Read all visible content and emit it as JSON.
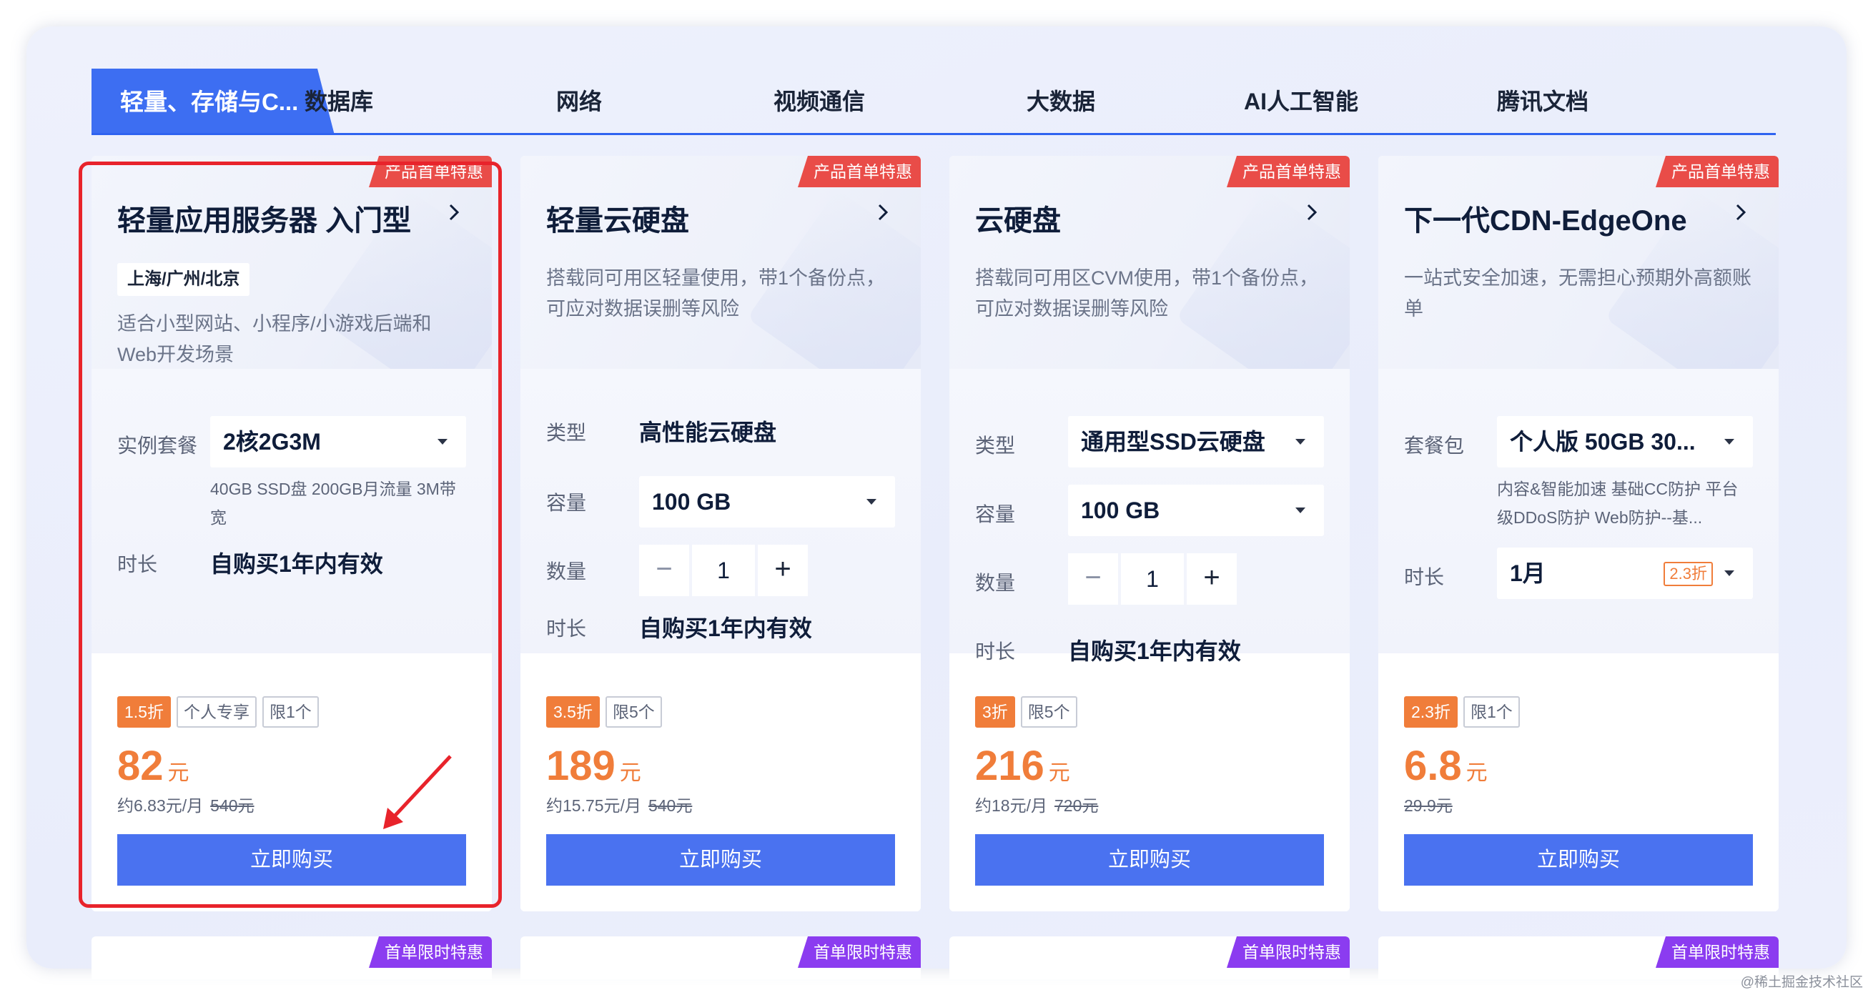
{
  "tabs": {
    "active": "轻量、存储与C...",
    "items": [
      "数据库",
      "网络",
      "视频通信",
      "大数据",
      "AI人工智能",
      "腾讯文档"
    ]
  },
  "cards": [
    {
      "badge": "产品首单特惠",
      "title": "轻量应用服务器 入门型",
      "region": "上海/广州/北京",
      "desc": "适合小型网站、小程序/小游戏后端和Web开发场景",
      "label_instance": "实例套餐",
      "instance_value": "2核2G3M",
      "instance_note": "40GB SSD盘 200GB月流量 3M带宽",
      "label_duration": "时长",
      "duration_value": "自购买1年内有效",
      "tags": [
        "1.5折",
        "个人专享",
        "限1个"
      ],
      "price": "82",
      "unit": "元",
      "monthly": "约6.83元/月",
      "original": "540元",
      "buy_label": "立即购买"
    },
    {
      "badge": "产品首单特惠",
      "title": "轻量云硬盘",
      "desc": "搭载同可用区轻量使用，带1个备份点，可应对数据误删等风险",
      "label_type": "类型",
      "type_value": "高性能云硬盘",
      "label_capacity": "容量",
      "capacity_value": "100 GB",
      "label_quantity": "数量",
      "stepper": {
        "minus": "−",
        "qty": "1",
        "plus": "+"
      },
      "label_duration": "时长",
      "duration_value": "自购买1年内有效",
      "tags": [
        "3.5折",
        "限5个"
      ],
      "price": "189",
      "unit": "元",
      "monthly": "约15.75元/月",
      "original": "540元",
      "buy_label": "立即购买"
    },
    {
      "badge": "产品首单特惠",
      "title": "云硬盘",
      "desc": "搭载同可用区CVM使用，带1个备份点，可应对数据误删等风险",
      "label_type": "类型",
      "type_value": "通用型SSD云硬盘",
      "label_capacity": "容量",
      "capacity_value": "100 GB",
      "label_quantity": "数量",
      "stepper": {
        "minus": "−",
        "qty": "1",
        "plus": "+"
      },
      "label_duration": "时长",
      "duration_value": "自购买1年内有效",
      "tags": [
        "3折",
        "限5个"
      ],
      "price": "216",
      "unit": "元",
      "monthly": "约18元/月",
      "original": "720元",
      "buy_label": "立即购买"
    },
    {
      "badge": "产品首单特惠",
      "title": "下一代CDN-EdgeOne",
      "desc": "一站式安全加速，无需担心预期外高额账单",
      "label_package": "套餐包",
      "package_value": "个人版 50GB 30...",
      "package_note": "内容&智能加速 基础CC防护 平台级DDoS防护 Web防护--基...",
      "label_duration": "时长",
      "duration_value": "1月",
      "duration_discount": "2.3折",
      "tags": [
        "2.3折",
        "限1个"
      ],
      "price": "6.8",
      "unit": "元",
      "original": "29.9元",
      "buy_label": "立即购买"
    }
  ],
  "next_badges": [
    "首单限时特惠",
    "首单限时特惠",
    "首单限时特惠",
    "首单限时特惠"
  ],
  "watermark": "@稀土掘金技术社区",
  "colors": {
    "accent": "#3d6ef2",
    "buy_button": "#4a72f0",
    "price": "#f07d3a",
    "badge_red": "#e94c48",
    "badge_purple": "#8b3cf0",
    "highlight": "#e8232b"
  }
}
